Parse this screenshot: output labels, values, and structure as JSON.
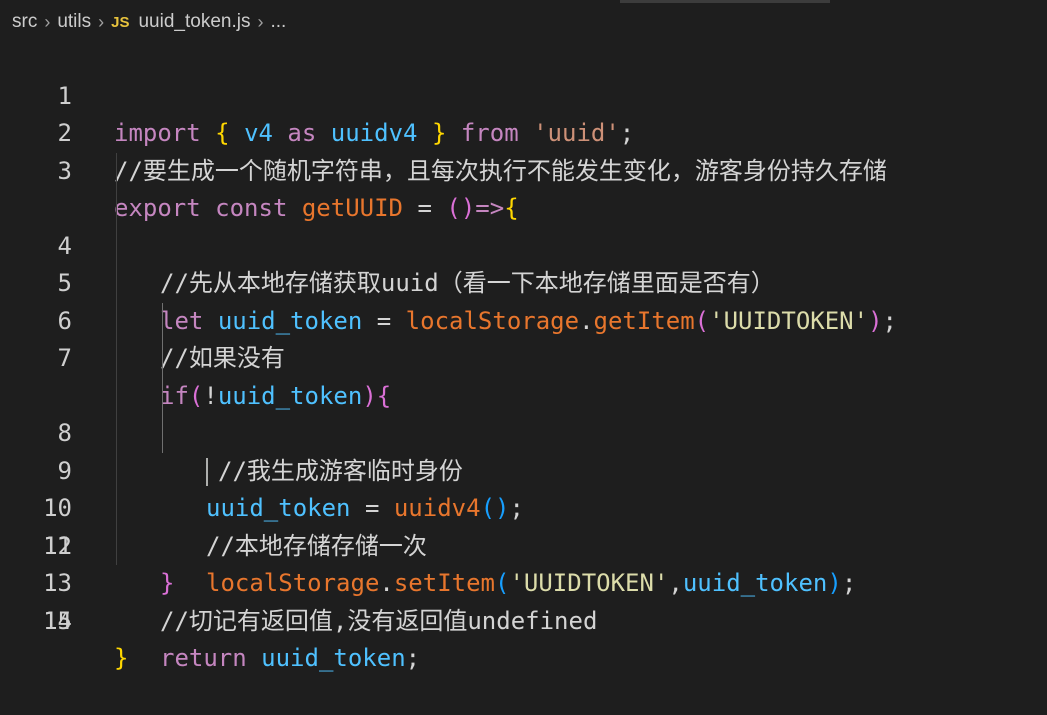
{
  "breadcrumb": {
    "folder1": "src",
    "folder2": "utils",
    "file_badge": "JS",
    "file": "uuid_token.js",
    "more": "..."
  },
  "lines": [
    {
      "n": "1",
      "t": [
        "import",
        " ",
        "{",
        " ",
        "v4",
        " ",
        "as",
        " ",
        "uuidv4",
        " ",
        "}",
        " ",
        "from",
        " ",
        "'uuid'",
        ";"
      ]
    },
    {
      "n": "2",
      "t": [
        "//要生成一个随机字符串，且每次执行不能发生变化，游客身份持久存储"
      ]
    },
    {
      "n": "3",
      "t": [
        "export",
        " ",
        "const",
        " ",
        "getUUID",
        " ",
        "=",
        " ",
        "()",
        "=>",
        "{"
      ]
    },
    {
      "n": "4",
      "t": [
        "//先从本地存储获取uuid（看一下本地存储里面是否有）"
      ]
    },
    {
      "n": "5",
      "t": [
        "let",
        " ",
        "uuid_token",
        " ",
        "=",
        " ",
        "localStorage",
        ".",
        "getItem",
        "(",
        "'UUIDTOKEN'",
        ")",
        ";"
      ]
    },
    {
      "n": "6",
      "t": [
        "//如果没有"
      ]
    },
    {
      "n": "7",
      "t": [
        "if",
        "(",
        "!",
        "uuid_token",
        ")",
        "{"
      ]
    },
    {
      "n": "8",
      "t": [
        "//我生成游客临时身份"
      ]
    },
    {
      "n": "9",
      "t": [
        "uuid_token",
        " ",
        "=",
        " ",
        "uuidv4",
        "()",
        ";"
      ]
    },
    {
      "n": "10",
      "t": [
        "//本地存储存储一次"
      ]
    },
    {
      "n": "11",
      "t": [
        "localStorage",
        ".",
        "setItem",
        "(",
        "'UUIDTOKEN'",
        ",",
        "uuid_token",
        ")",
        ";"
      ]
    },
    {
      "n": "12",
      "t": [
        "}"
      ]
    },
    {
      "n": "13",
      "t": [
        "//切记有返回值,没有返回值undefined"
      ]
    },
    {
      "n": "14",
      "t": [
        "return",
        " ",
        "uuid_token",
        ";"
      ]
    },
    {
      "n": "15",
      "t": [
        "}"
      ]
    }
  ]
}
